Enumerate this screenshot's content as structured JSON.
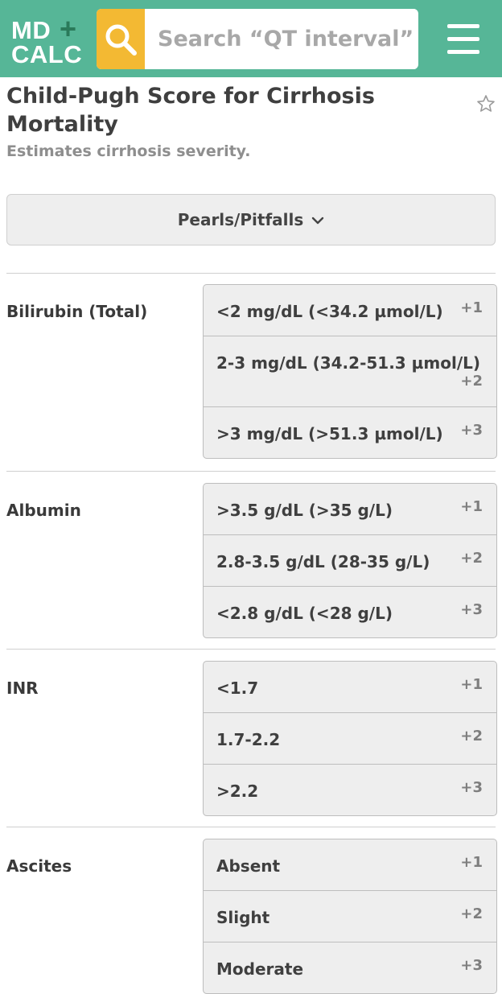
{
  "header": {
    "logo_line1": "MD",
    "logo_plus": "+",
    "logo_line2": "CALC",
    "search_placeholder": "Search “QT interval”",
    "search_icon": "search-icon",
    "menu_icon": "hamburger-menu-icon",
    "colors": {
      "bar": "#56b697",
      "search_button": "#f3b933"
    }
  },
  "page": {
    "title": "Child-Pugh Score for Cirrhosis Mortality",
    "subtitle": "Estimates cirrhosis severity.",
    "favorite_icon": "star-icon",
    "pearls_label": "Pearls/Pitfalls"
  },
  "criteria": [
    {
      "label": "Bilirubin (Total)",
      "options": [
        {
          "label": "<2 mg/dL (<34.2 µmol/L)",
          "points": "+1"
        },
        {
          "label": "2-3 mg/dL (34.2-51.3 µmol/L)",
          "points": "+2"
        },
        {
          "label": ">3 mg/dL (>51.3 µmol/L)",
          "points": "+3"
        }
      ]
    },
    {
      "label": "Albumin",
      "options": [
        {
          "label": ">3.5 g/dL (>35 g/L)",
          "points": "+1"
        },
        {
          "label": "2.8-3.5 g/dL (28-35 g/L)",
          "points": "+2"
        },
        {
          "label": "<2.8 g/dL (<28 g/L)",
          "points": "+3"
        }
      ]
    },
    {
      "label": "INR",
      "options": [
        {
          "label": "<1.7",
          "points": "+1"
        },
        {
          "label": "1.7-2.2",
          "points": "+2"
        },
        {
          "label": ">2.2",
          "points": "+3"
        }
      ]
    },
    {
      "label": "Ascites",
      "options": [
        {
          "label": "Absent",
          "points": "+1"
        },
        {
          "label": "Slight",
          "points": "+2"
        },
        {
          "label": "Moderate",
          "points": "+3"
        }
      ]
    }
  ]
}
